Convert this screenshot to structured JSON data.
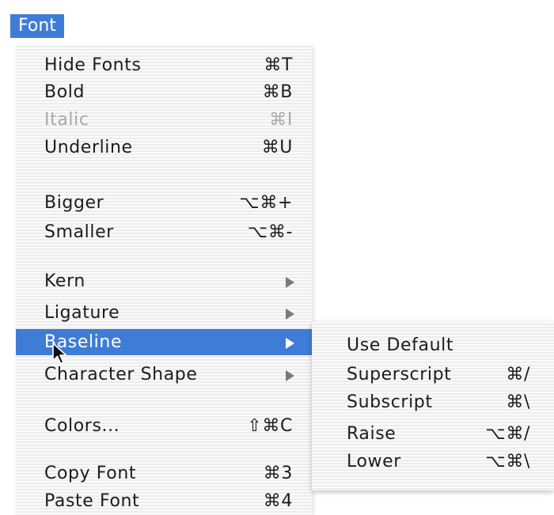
{
  "menubar": {
    "title": "Font"
  },
  "menu": {
    "items": [
      {
        "label": "Hide Fonts",
        "shortcut": "⌘T"
      },
      {
        "label": "Bold",
        "shortcut": "⌘B"
      },
      {
        "label": "Italic",
        "shortcut": "⌘I"
      },
      {
        "label": "Underline",
        "shortcut": "⌘U"
      },
      {
        "label": "Bigger",
        "shortcut": "⌥⌘+"
      },
      {
        "label": "Smaller",
        "shortcut": "⌥⌘-"
      },
      {
        "label": "Kern",
        "submenu_icon": "triangle-right-icon"
      },
      {
        "label": "Ligature",
        "submenu_icon": "triangle-right-icon"
      },
      {
        "label": "Baseline",
        "submenu_icon": "triangle-right-icon"
      },
      {
        "label": "Character Shape",
        "submenu_icon": "triangle-right-icon"
      },
      {
        "label": "Colors...",
        "shortcut": "⇧⌘C"
      },
      {
        "label": "Copy Font",
        "shortcut": "⌘3"
      },
      {
        "label": "Paste Font",
        "shortcut": "⌘4"
      }
    ]
  },
  "submenu": {
    "items": [
      {
        "label": "Use Default"
      },
      {
        "label": "Superscript",
        "shortcut": "⌘/"
      },
      {
        "label": "Subscript",
        "shortcut": "⌘\\"
      },
      {
        "label": "Raise",
        "shortcut": "⌥⌘/"
      },
      {
        "label": "Lower",
        "shortcut": "⌥⌘\\"
      }
    ]
  },
  "state": {
    "highlighted_item": "Baseline",
    "disabled_item": "Italic",
    "cursor_icon": "arrow-pointer-icon"
  },
  "colors": {
    "highlight": "#3f7cd6",
    "text": "#1c1c1c",
    "disabled_text": "#a8a8a8",
    "menu_stripe_light": "#fbfbfb",
    "menu_stripe_dark": "#ececec"
  }
}
